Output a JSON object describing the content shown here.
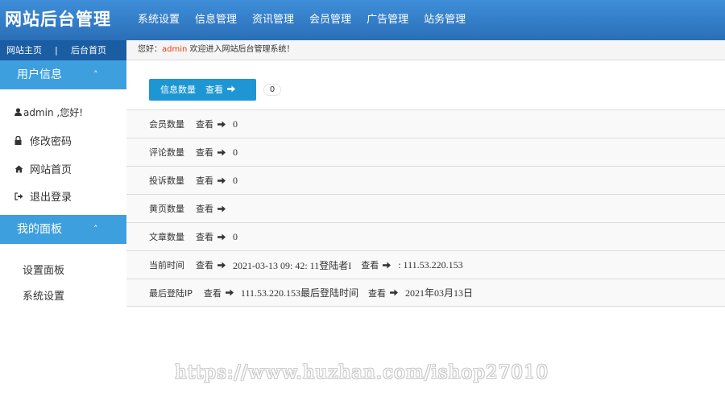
{
  "app": {
    "logo": "网站后台管理",
    "top_nav": [
      "系统设置",
      "信息管理",
      "资讯管理",
      "会员管理",
      "广告管理",
      "站务管理"
    ],
    "sub_links": {
      "site_home": "网站主页",
      "separator": "|",
      "admin_home": "后台首页"
    }
  },
  "welcome": {
    "prefix": "您好：",
    "user": "admin",
    "suffix": " 欢迎进入网站后台管理系统！"
  },
  "sidebar": {
    "user_section": {
      "title": "用户信息",
      "chevron": "˄"
    },
    "user_greeting": "admin ,您好!",
    "change_password": "修改密码",
    "site_home": "网站首页",
    "logout": "退出登录",
    "panel_section": {
      "title": "我的面板",
      "chevron": "˄"
    },
    "panel_settings": "设置面板",
    "system_settings": "系统设置"
  },
  "main": {
    "info_button": {
      "label": "信息数量",
      "view": "查看"
    },
    "info_count": "0",
    "view_label": "查看",
    "rows": [
      {
        "label": "会员数量",
        "value": "0"
      },
      {
        "label": "评论数量",
        "value": "0"
      },
      {
        "label": "投诉数量",
        "value": "0"
      },
      {
        "label": "黄页数量",
        "value": ""
      },
      {
        "label": "文章数量",
        "value": "0"
      }
    ],
    "time_row": {
      "label": "当前时间",
      "value": "2021-03-13 09: 42: 11登陆者I",
      "value2": ": 111.53.220.153"
    },
    "ip_row": {
      "label": "最后登陆IP",
      "value": "111.53.220.153最后登陆时间",
      "value2": "2021年03月13日"
    }
  },
  "watermark": "https://www.huzhan.com/ishop27010",
  "colors": {
    "topbar": "#2a6fb7",
    "section_header": "#3e9fde",
    "button": "#1e96d3",
    "username": "#e23c18"
  }
}
